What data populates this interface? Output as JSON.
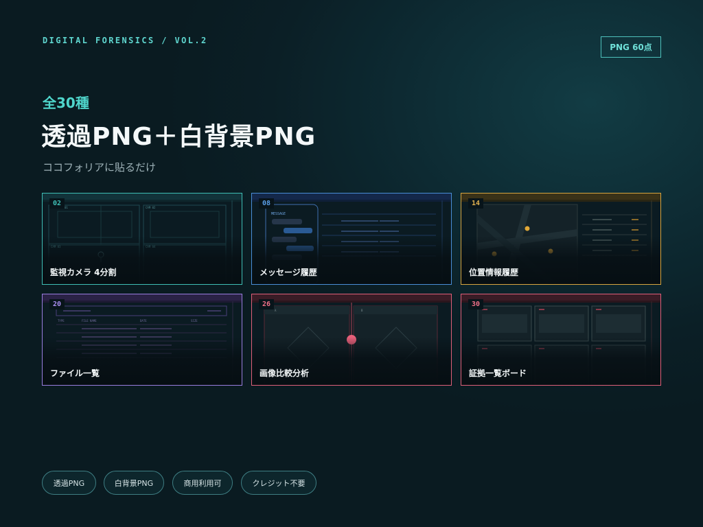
{
  "header": {
    "eyebrow": "DIGITAL FORENSICS / VOL.2",
    "badge": "PNG 60点",
    "kicker": "全30種",
    "headline": "透過PNG＋白背景PNG",
    "subline": "ココフォリアに貼るだけ"
  },
  "cards": [
    {
      "number": "02",
      "label": "監視カメラ 4分割",
      "accent": "#3fbfb6"
    },
    {
      "number": "08",
      "label": "メッセージ履歴",
      "accent": "#4a8fd8"
    },
    {
      "number": "14",
      "label": "位置情報履歴",
      "accent": "#d9a640"
    },
    {
      "number": "20",
      "label": "ファイル一覧",
      "accent": "#9a7ee0"
    },
    {
      "number": "26",
      "label": "画像比較分析",
      "accent": "#e0607a"
    },
    {
      "number": "30",
      "label": "証拠一覧ボード",
      "accent": "#e0607a"
    }
  ],
  "previews": {
    "camera_labels": [
      "01",
      "CAM 02",
      "CAM 03",
      "CAM 04"
    ],
    "message_heading": "MESSAGE",
    "compare_labels": [
      "A",
      "B"
    ],
    "file_headers": [
      "TYPE",
      "FILE NAME",
      "DATE",
      "SIZE"
    ]
  },
  "tags": [
    "透過PNG",
    "白背景PNG",
    "商用利用可",
    "クレジット不要"
  ],
  "colors": {
    "background": "#0c222a",
    "accent": "#4fd5cb",
    "heading": "#f4f8f9"
  }
}
